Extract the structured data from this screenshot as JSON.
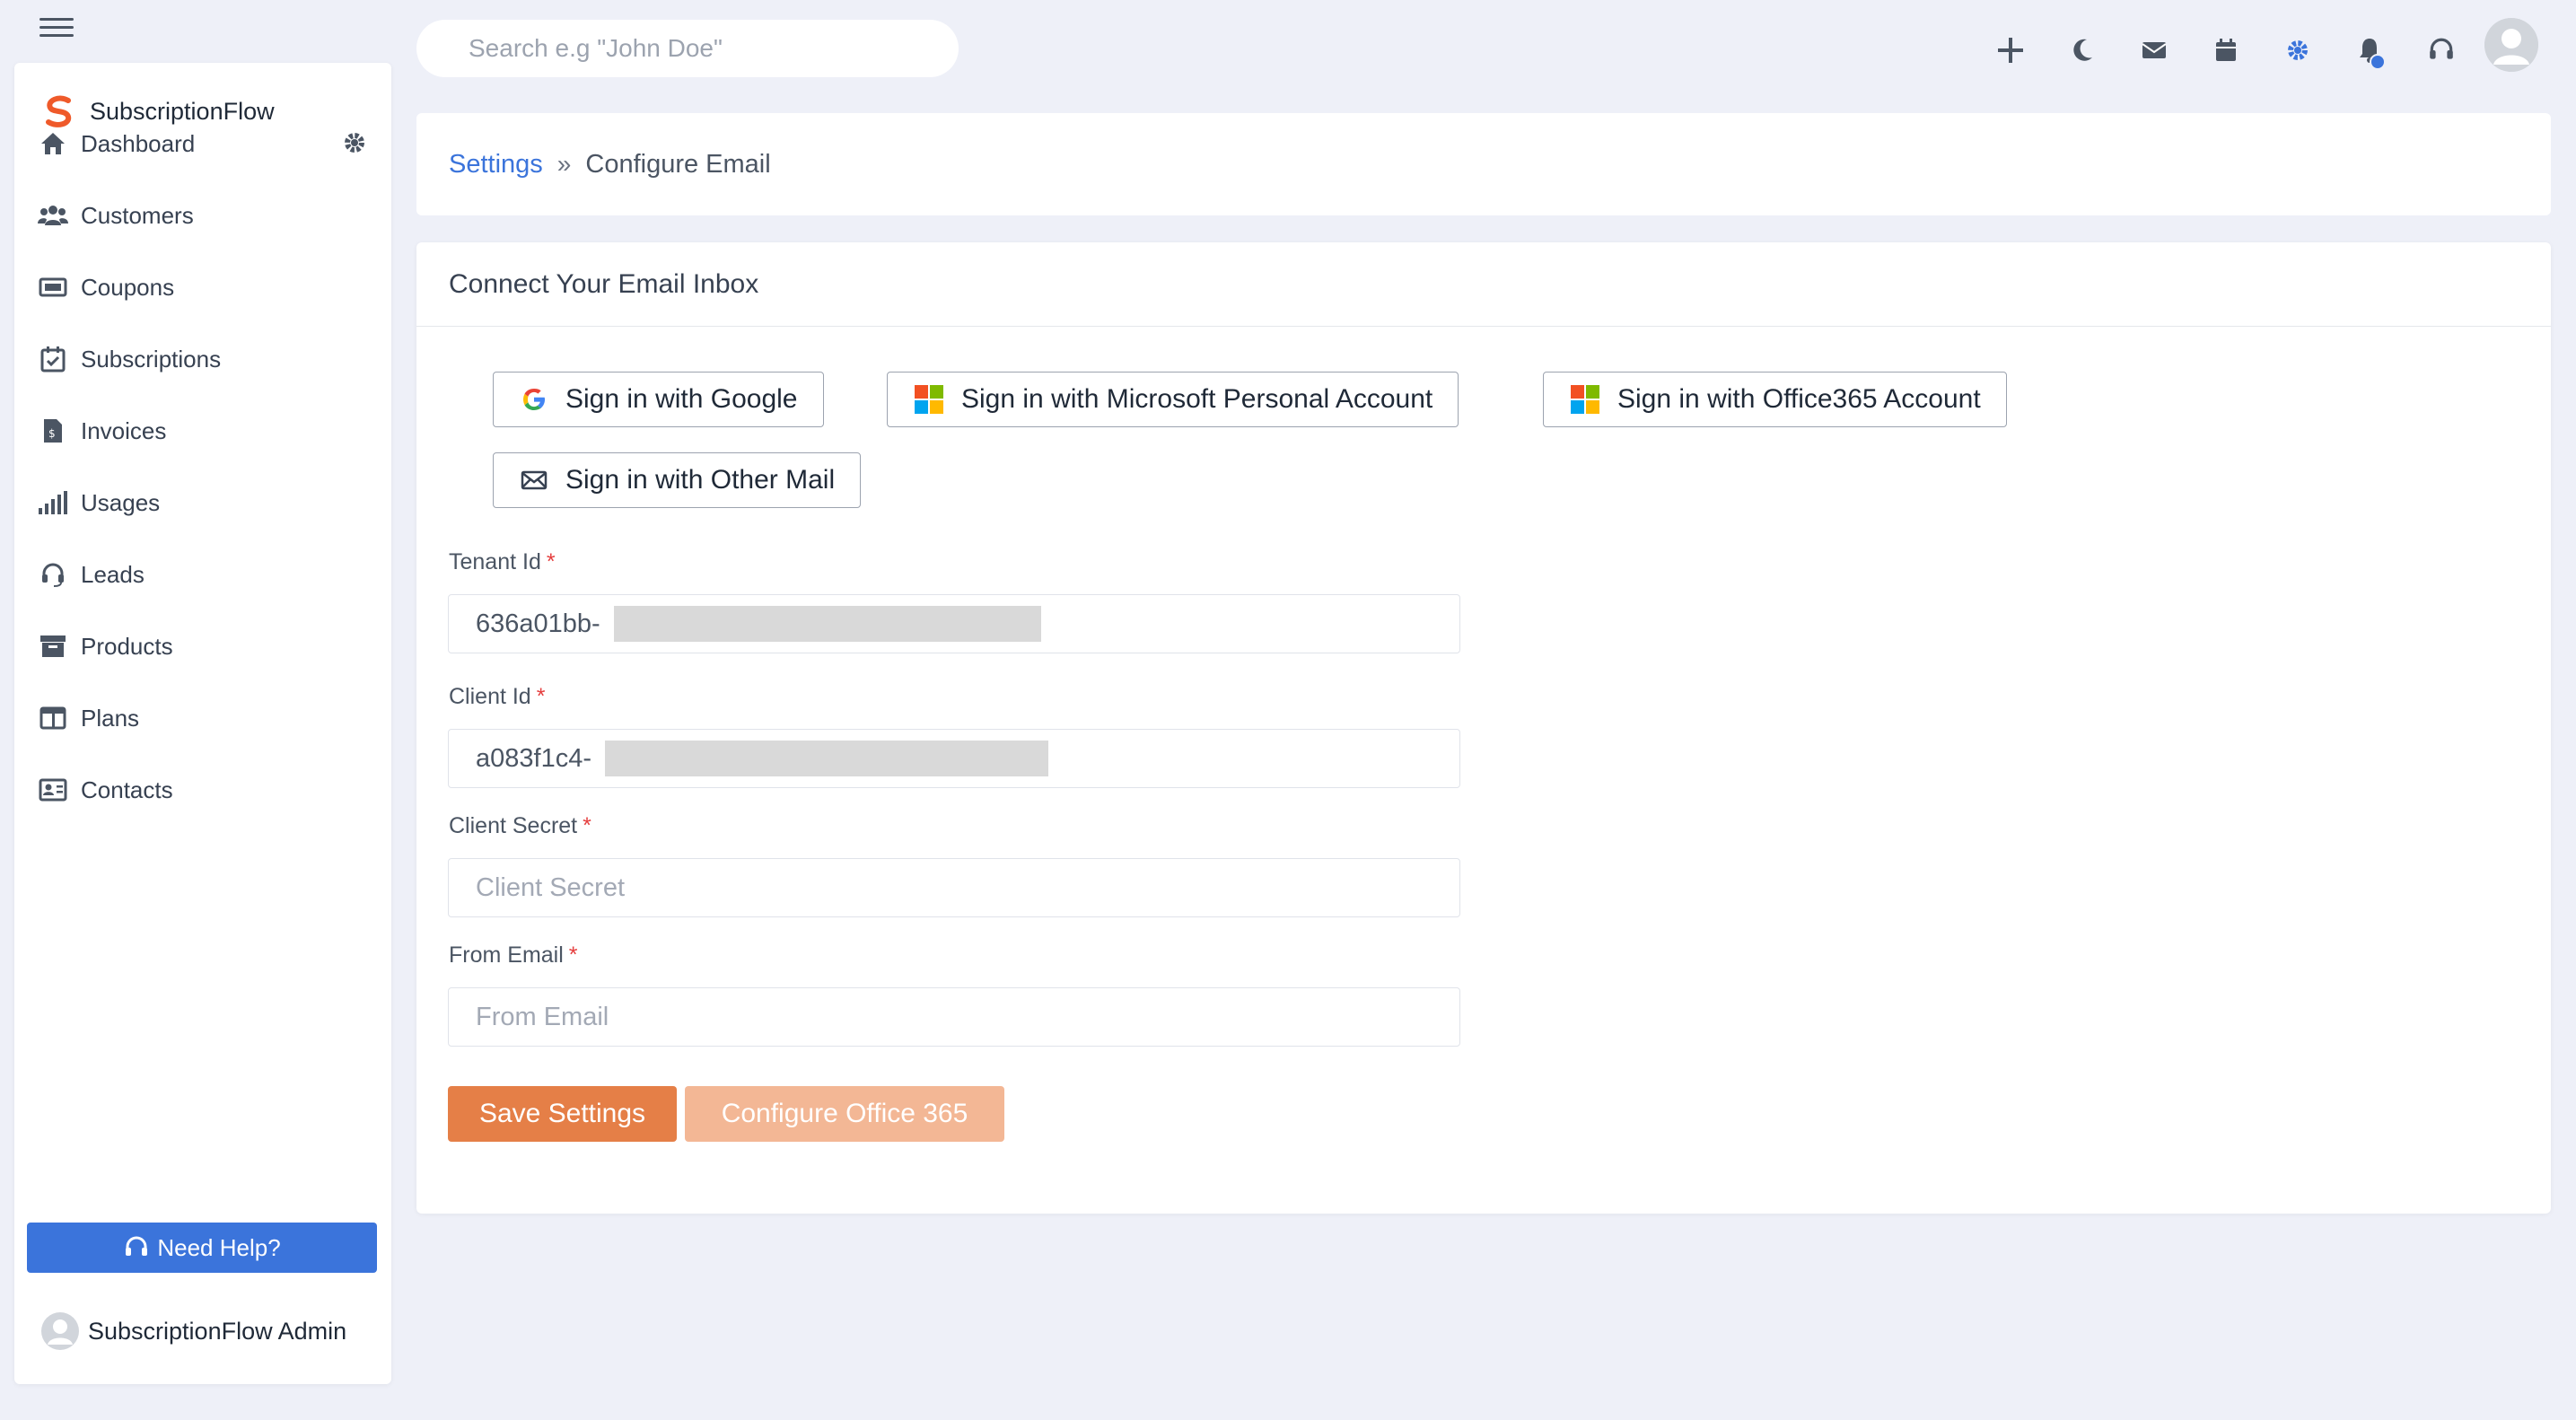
{
  "brand": {
    "name": "SubscriptionFlow"
  },
  "search": {
    "placeholder": "Search e.g \"John Doe\""
  },
  "sidebar": {
    "items": [
      {
        "label": "Dashboard",
        "icon": "home-icon"
      },
      {
        "label": "Customers",
        "icon": "users-icon"
      },
      {
        "label": "Coupons",
        "icon": "ticket-icon"
      },
      {
        "label": "Subscriptions",
        "icon": "calendar-check-icon"
      },
      {
        "label": "Invoices",
        "icon": "invoice-icon"
      },
      {
        "label": "Usages",
        "icon": "signal-bars-icon"
      },
      {
        "label": "Leads",
        "icon": "headset-icon"
      },
      {
        "label": "Products",
        "icon": "archive-icon"
      },
      {
        "label": "Plans",
        "icon": "columns-icon"
      },
      {
        "label": "Contacts",
        "icon": "contact-card-icon"
      }
    ],
    "help_label": "Need Help?",
    "admin_name": "SubscriptionFlow Admin"
  },
  "topbar": {
    "icons": [
      "plus-icon",
      "moon-icon",
      "envelope-icon",
      "calendar-icon",
      "gear-icon",
      "bell-icon",
      "headset-icon",
      "avatar"
    ]
  },
  "breadcrumb": {
    "parent": "Settings",
    "separator": "»",
    "current": "Configure Email"
  },
  "card": {
    "title": "Connect Your Email Inbox",
    "sso": {
      "google": "Sign in with Google",
      "microsoft": "Sign in with Microsoft Personal Account",
      "office365": "Sign in with Office365 Account",
      "other": "Sign in with Other Mail"
    },
    "fields": {
      "tenant_label": "Tenant Id",
      "tenant_value": "636a01bb-",
      "client_label": "Client Id",
      "client_value": "a083f1c4-",
      "secret_label": "Client Secret",
      "secret_placeholder": "Client Secret",
      "from_label": "From Email",
      "from_placeholder": "From Email",
      "required_mark": "*"
    },
    "save_label": "Save Settings",
    "configure_label": "Configure Office 365"
  },
  "colors": {
    "accent": "#3b74db",
    "primary_button": "#e57f47",
    "secondary_button": "#f3b795",
    "background": "#eef0f8"
  }
}
